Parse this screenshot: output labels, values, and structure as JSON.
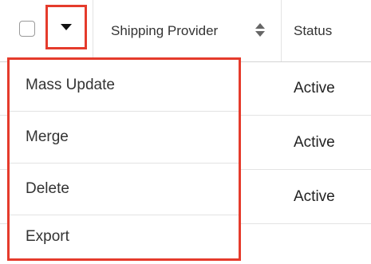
{
  "header": {
    "checkbox_checked": false,
    "actions_dropdown_icon": "caret-down-icon",
    "columns": [
      {
        "label": "Shipping Provider",
        "sort_icon": "sort-icon"
      },
      {
        "label": "Status"
      }
    ]
  },
  "rows": [
    {
      "status": "Active"
    },
    {
      "status": "Active"
    },
    {
      "status": "Active"
    }
  ],
  "actions_menu": {
    "items": [
      {
        "label": "Mass Update"
      },
      {
        "label": "Merge"
      },
      {
        "label": "Delete"
      },
      {
        "label": "Export"
      }
    ]
  },
  "colors": {
    "highlight": "#e53b2c",
    "border": "#e3e3e3"
  }
}
